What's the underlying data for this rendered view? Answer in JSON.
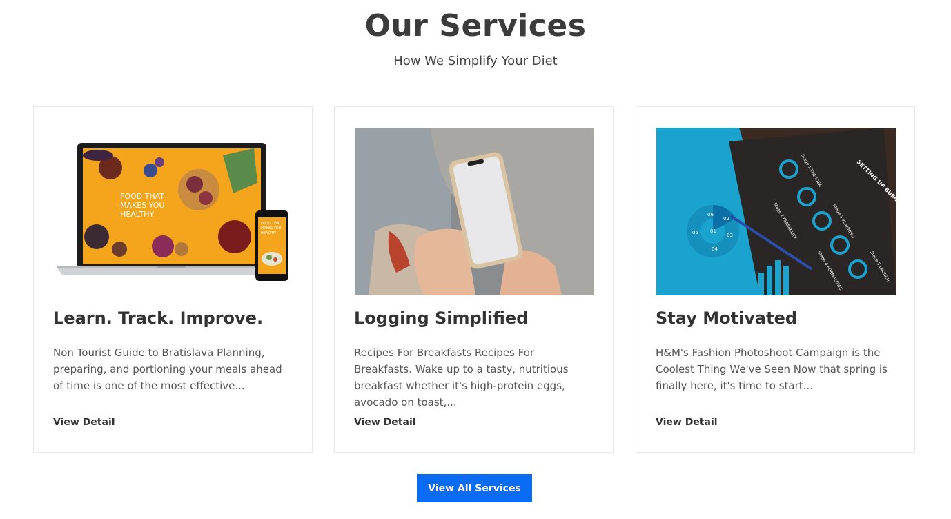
{
  "section": {
    "title": "Our Services",
    "subtitle": "How We Simplify Your Diet"
  },
  "cards": [
    {
      "title": "Learn. Track. Improve.",
      "text": "Non Tourist Guide to Bratislava Planning, preparing, and portioning your meals ahead of time is one of the most effective...",
      "link": "View Detail",
      "image": {
        "laptop_text_line1": "FOOD THAT",
        "laptop_text_line2": "MAKES YOU",
        "laptop_text_line3": "HEALTHY",
        "phone_text_line1": "FOOD THAT",
        "phone_text_line2": "MAKES YOU",
        "phone_text_line3": "HEALTHY"
      }
    },
    {
      "title": "Logging Simplified",
      "text": "Recipes For Breakfasts Recipes For Breakfasts. Wake up to a tasty, nutritious breakfast whether it's high-protein eggs, avocado on toast,...",
      "link": "View Detail"
    },
    {
      "title": "Stay Motivated",
      "text": "H&M's Fashion Photoshoot Campaign is the Coolest Thing We've Seen Now that spring is finally here, it's time to start...",
      "link": "View Detail",
      "image": {
        "sheet_heading": "SETTING UP BUSINESS",
        "stage1": "Stage 1 THE IDEA",
        "stage2": "Stage 2 FEASIBILITY",
        "stage3": "Stage 3 PLANNING",
        "stage4": "Stage 4 FORMALITIES",
        "stage5": "Stage 5 LAUNCH",
        "circle_labels": [
          "01",
          "02",
          "03",
          "04",
          "05",
          "06"
        ]
      }
    }
  ],
  "cta": {
    "label": "View All Services"
  },
  "colors": {
    "button": "#0a6cf5",
    "heading": "#3b3b3b",
    "food_background": "#f4a51c",
    "infographic_blue": "#1aa3cf",
    "infographic_dark": "#2a2626"
  }
}
